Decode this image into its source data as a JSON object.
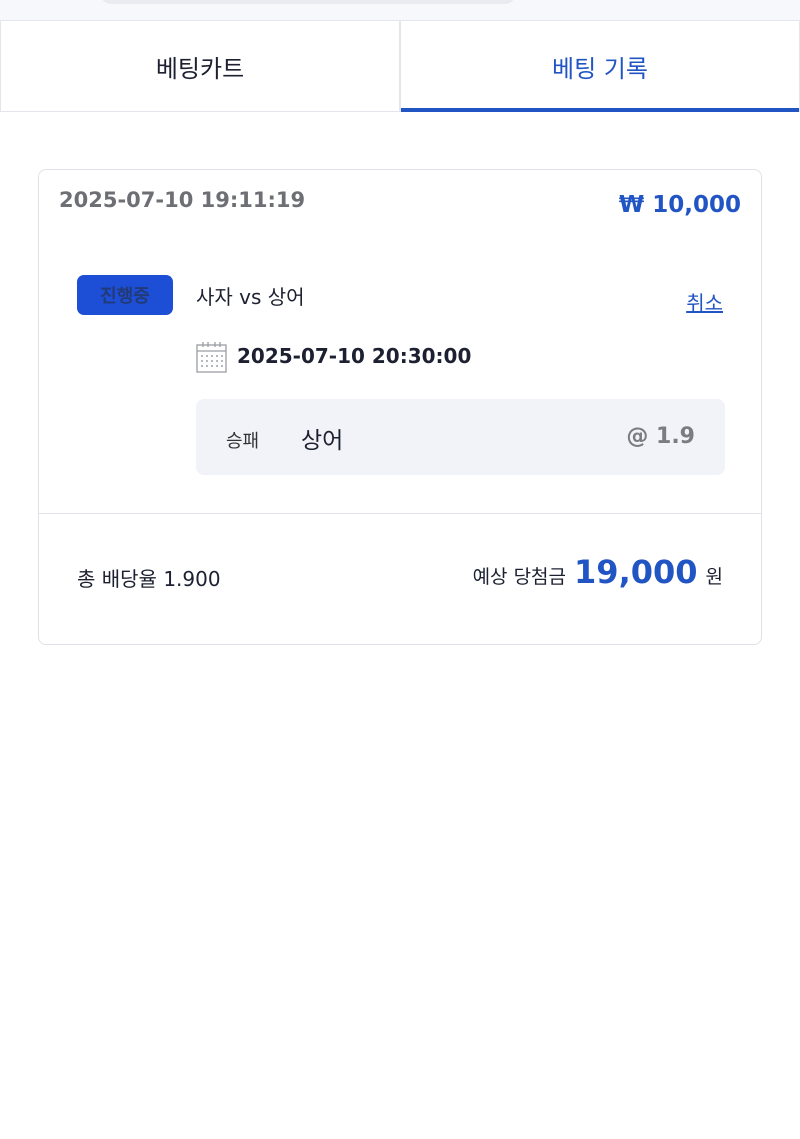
{
  "tabs": [
    {
      "label": "베팅카트",
      "active": false
    },
    {
      "label": "베팅 기록",
      "active": true
    }
  ],
  "bet": {
    "placed_at": "2025-07-10 19:11:19",
    "stake": "₩ 10,000",
    "status": "진행중",
    "match": "사자 vs 상어",
    "cancel_label": "취소",
    "game_time": "2025-07-10 20:30:00",
    "pick": {
      "market": "승패",
      "selection": "상어",
      "odds": "@ 1.9"
    },
    "total_odds": "총 배당율 1.900",
    "expected_label": "예상 당첨금",
    "expected_value": "19,000",
    "expected_unit": "원"
  },
  "icons": {
    "calendar": "calendar-icon"
  },
  "colors": {
    "accent": "#2255c4",
    "badge": "#1c4fd6",
    "pick_bg": "#f1f3f8"
  }
}
